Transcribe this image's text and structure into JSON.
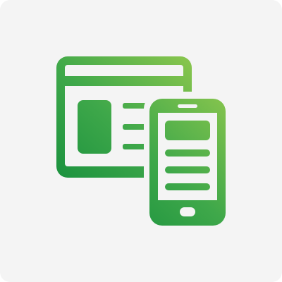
{
  "icon": {
    "name": "responsive-web-and-mobile-icon",
    "colors": {
      "tile_background": "#f4f4f4",
      "gradient_light": "#a8d24f",
      "gradient_dark": "#0e8a3a",
      "cutout": "#f4f4f4"
    }
  }
}
